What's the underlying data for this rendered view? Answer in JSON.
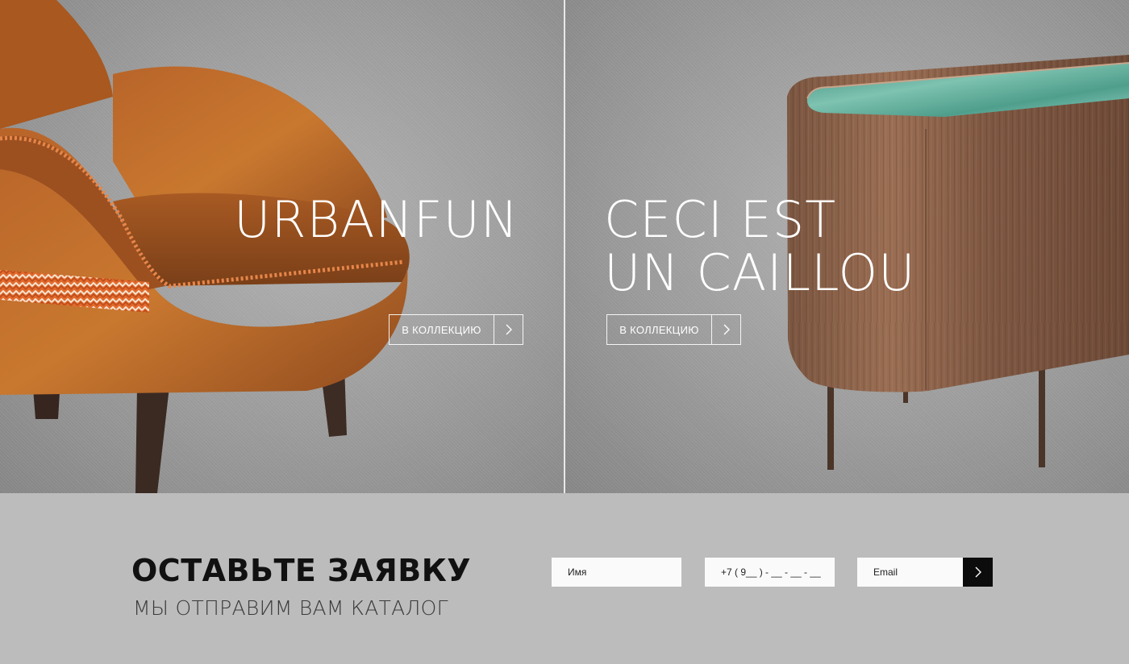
{
  "hero": {
    "left": {
      "title": "URBANFUN",
      "cta_label": "В КОЛЛЕКЦИЮ",
      "image_icon": "armchair-image"
    },
    "right": {
      "title": "CECI EST\nUN CAILLOU",
      "cta_label": "В КОЛЛЕКЦИЮ",
      "image_icon": "sideboard-image"
    }
  },
  "form": {
    "heading": "ОСТАВЬТЕ ЗАЯВКУ",
    "subheading": "МЫ ОТПРАВИМ ВАМ КАТАЛОГ",
    "name_placeholder": "Имя",
    "phone_placeholder": "+7 ( 9__ ) - __ - __ - __",
    "email_placeholder": "Email",
    "submit_icon": "chevron-right-icon"
  },
  "colors": {
    "hero_background": "#9a9a9a",
    "form_background": "#bcbcbc",
    "submit_background": "#0c0c0c",
    "text_light": "#ffffff",
    "text_dark": "#111111"
  }
}
